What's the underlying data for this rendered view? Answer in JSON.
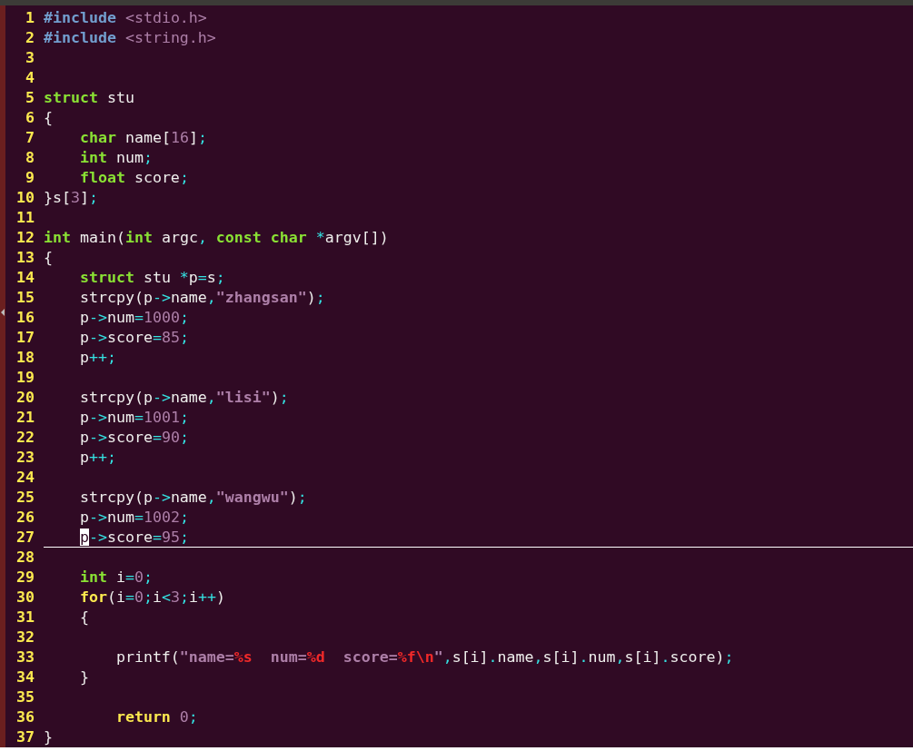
{
  "lines": [
    {
      "number": "1",
      "current": false,
      "tokens": [
        {
          "t": "#include",
          "kind": "pre"
        },
        {
          "t": " <stdio.h>",
          "kind": "inc"
        }
      ]
    },
    {
      "number": "2",
      "current": false,
      "tokens": [
        {
          "t": "#include",
          "kind": "pre"
        },
        {
          "t": " <string.h>",
          "kind": "inc"
        }
      ]
    },
    {
      "number": "3",
      "current": false
    },
    {
      "number": "4",
      "current": false
    },
    {
      "number": "5",
      "current": false,
      "tokens": [
        {
          "t": "struct",
          "kind": "type"
        },
        {
          "t": " stu",
          "kind": "plain"
        }
      ]
    },
    {
      "number": "6",
      "current": false,
      "tokens": [
        {
          "t": "{",
          "kind": "plain"
        }
      ]
    },
    {
      "number": "7",
      "current": false,
      "tokens": [
        {
          "t": "    char",
          "kind": "type"
        },
        {
          "t": " name[",
          "kind": "plain"
        },
        {
          "t": "16",
          "kind": "num"
        },
        {
          "t": "]",
          "kind": "plain"
        },
        {
          "t": ";",
          "kind": "op"
        }
      ]
    },
    {
      "number": "8",
      "current": false,
      "tokens": [
        {
          "t": "    int",
          "kind": "type"
        },
        {
          "t": " num",
          "kind": "plain"
        },
        {
          "t": ";",
          "kind": "op"
        }
      ]
    },
    {
      "number": "9",
      "current": false,
      "tokens": [
        {
          "t": "    float",
          "kind": "type"
        },
        {
          "t": " score",
          "kind": "plain"
        },
        {
          "t": ";",
          "kind": "op"
        }
      ]
    },
    {
      "number": "10",
      "current": false,
      "tokens": [
        {
          "t": "}s[",
          "kind": "plain"
        },
        {
          "t": "3",
          "kind": "num"
        },
        {
          "t": "]",
          "kind": "plain"
        },
        {
          "t": ";",
          "kind": "op"
        }
      ]
    },
    {
      "number": "11",
      "current": false
    },
    {
      "number": "12",
      "current": false,
      "tokens": [
        {
          "t": "int",
          "kind": "type"
        },
        {
          "t": " main(",
          "kind": "plain"
        },
        {
          "t": "int",
          "kind": "type"
        },
        {
          "t": " argc",
          "kind": "plain"
        },
        {
          "t": ",",
          "kind": "op"
        },
        {
          "t": " const",
          "kind": "type"
        },
        {
          "t": " char",
          "kind": "type"
        },
        {
          "t": " *",
          "kind": "op"
        },
        {
          "t": "argv[])",
          "kind": "plain"
        }
      ]
    },
    {
      "number": "13",
      "current": false,
      "tokens": [
        {
          "t": "{",
          "kind": "plain"
        }
      ]
    },
    {
      "number": "14",
      "current": false,
      "tokens": [
        {
          "t": "    struct",
          "kind": "type"
        },
        {
          "t": " stu ",
          "kind": "plain"
        },
        {
          "t": "*",
          "kind": "op"
        },
        {
          "t": "p",
          "kind": "plain"
        },
        {
          "t": "=",
          "kind": "op"
        },
        {
          "t": "s",
          "kind": "plain"
        },
        {
          "t": ";",
          "kind": "op"
        }
      ]
    },
    {
      "number": "15",
      "current": false,
      "tokens": [
        {
          "t": "    strcpy(p",
          "kind": "plain"
        },
        {
          "t": "->",
          "kind": "op"
        },
        {
          "t": "name",
          "kind": "plain"
        },
        {
          "t": ",",
          "kind": "op"
        },
        {
          "t": "\"zhangsan\"",
          "kind": "str"
        },
        {
          "t": ")",
          "kind": "plain"
        },
        {
          "t": ";",
          "kind": "op"
        }
      ]
    },
    {
      "number": "16",
      "current": false,
      "tokens": [
        {
          "t": "    p",
          "kind": "plain"
        },
        {
          "t": "->",
          "kind": "op"
        },
        {
          "t": "num",
          "kind": "plain"
        },
        {
          "t": "=",
          "kind": "op"
        },
        {
          "t": "1000",
          "kind": "num"
        },
        {
          "t": ";",
          "kind": "op"
        }
      ]
    },
    {
      "number": "17",
      "current": false,
      "tokens": [
        {
          "t": "    p",
          "kind": "plain"
        },
        {
          "t": "->",
          "kind": "op"
        },
        {
          "t": "score",
          "kind": "plain"
        },
        {
          "t": "=",
          "kind": "op"
        },
        {
          "t": "85",
          "kind": "num"
        },
        {
          "t": ";",
          "kind": "op"
        }
      ]
    },
    {
      "number": "18",
      "current": false,
      "tokens": [
        {
          "t": "    p",
          "kind": "plain"
        },
        {
          "t": "++;",
          "kind": "op"
        }
      ]
    },
    {
      "number": "19",
      "current": false
    },
    {
      "number": "20",
      "current": false,
      "tokens": [
        {
          "t": "    strcpy(p",
          "kind": "plain"
        },
        {
          "t": "->",
          "kind": "op"
        },
        {
          "t": "name",
          "kind": "plain"
        },
        {
          "t": ",",
          "kind": "op"
        },
        {
          "t": "\"lisi\"",
          "kind": "str"
        },
        {
          "t": ")",
          "kind": "plain"
        },
        {
          "t": ";",
          "kind": "op"
        }
      ]
    },
    {
      "number": "21",
      "current": false,
      "tokens": [
        {
          "t": "    p",
          "kind": "plain"
        },
        {
          "t": "->",
          "kind": "op"
        },
        {
          "t": "num",
          "kind": "plain"
        },
        {
          "t": "=",
          "kind": "op"
        },
        {
          "t": "1001",
          "kind": "num"
        },
        {
          "t": ";",
          "kind": "op"
        }
      ]
    },
    {
      "number": "22",
      "current": false,
      "tokens": [
        {
          "t": "    p",
          "kind": "plain"
        },
        {
          "t": "->",
          "kind": "op"
        },
        {
          "t": "score",
          "kind": "plain"
        },
        {
          "t": "=",
          "kind": "op"
        },
        {
          "t": "90",
          "kind": "num"
        },
        {
          "t": ";",
          "kind": "op"
        }
      ]
    },
    {
      "number": "23",
      "current": false,
      "tokens": [
        {
          "t": "    p",
          "kind": "plain"
        },
        {
          "t": "++;",
          "kind": "op"
        }
      ]
    },
    {
      "number": "24",
      "current": false
    },
    {
      "number": "25",
      "current": false,
      "tokens": [
        {
          "t": "    strcpy(p",
          "kind": "plain"
        },
        {
          "t": "->",
          "kind": "op"
        },
        {
          "t": "name",
          "kind": "plain"
        },
        {
          "t": ",",
          "kind": "op"
        },
        {
          "t": "\"wangwu\"",
          "kind": "str"
        },
        {
          "t": ")",
          "kind": "plain"
        },
        {
          "t": ";",
          "kind": "op"
        }
      ]
    },
    {
      "number": "26",
      "current": false,
      "tokens": [
        {
          "t": "    p",
          "kind": "plain"
        },
        {
          "t": "->",
          "kind": "op"
        },
        {
          "t": "num",
          "kind": "plain"
        },
        {
          "t": "=",
          "kind": "op"
        },
        {
          "t": "1002",
          "kind": "num"
        },
        {
          "t": ";",
          "kind": "op"
        }
      ]
    },
    {
      "number": "27",
      "current": true,
      "tokens": [
        {
          "t": "    p",
          "kind": "cursor"
        },
        {
          "t": "->",
          "kind": "op"
        },
        {
          "t": "score",
          "kind": "plain"
        },
        {
          "t": "=",
          "kind": "op"
        },
        {
          "t": "95",
          "kind": "num"
        },
        {
          "t": ";",
          "kind": "op"
        }
      ]
    },
    {
      "number": "28",
      "current": false
    },
    {
      "number": "29",
      "current": false,
      "tokens": [
        {
          "t": "    int",
          "kind": "type"
        },
        {
          "t": " i",
          "kind": "plain"
        },
        {
          "t": "=",
          "kind": "op"
        },
        {
          "t": "0",
          "kind": "num"
        },
        {
          "t": ";",
          "kind": "op"
        }
      ]
    },
    {
      "number": "30",
      "current": false,
      "tokens": [
        {
          "t": "    for",
          "kind": "kw"
        },
        {
          "t": "(i",
          "kind": "plain"
        },
        {
          "t": "=",
          "kind": "op"
        },
        {
          "t": "0",
          "kind": "num"
        },
        {
          "t": ";",
          "kind": "op"
        },
        {
          "t": "i",
          "kind": "plain"
        },
        {
          "t": "<",
          "kind": "op"
        },
        {
          "t": "3",
          "kind": "num"
        },
        {
          "t": ";",
          "kind": "op"
        },
        {
          "t": "i",
          "kind": "plain"
        },
        {
          "t": "++",
          "kind": "op"
        },
        {
          "t": ")",
          "kind": "plain"
        }
      ]
    },
    {
      "number": "31",
      "current": false,
      "tokens": [
        {
          "t": "    {",
          "kind": "plain"
        }
      ]
    },
    {
      "number": "32",
      "current": false
    },
    {
      "number": "33",
      "current": false,
      "tokens": [
        {
          "t": "        printf(",
          "kind": "plain"
        },
        {
          "t": "\"name=",
          "kind": "str"
        },
        {
          "t": "%s",
          "kind": "fmt"
        },
        {
          "t": "  num=",
          "kind": "str"
        },
        {
          "t": "%d",
          "kind": "fmt"
        },
        {
          "t": "  score=",
          "kind": "str"
        },
        {
          "t": "%f\\n",
          "kind": "fmt"
        },
        {
          "t": "\"",
          "kind": "str"
        },
        {
          "t": ",",
          "kind": "op"
        },
        {
          "t": "s[i]",
          "kind": "plain"
        },
        {
          "t": ".",
          "kind": "op"
        },
        {
          "t": "name",
          "kind": "plain"
        },
        {
          "t": ",",
          "kind": "op"
        },
        {
          "t": "s[i]",
          "kind": "plain"
        },
        {
          "t": ".",
          "kind": "op"
        },
        {
          "t": "num",
          "kind": "plain"
        },
        {
          "t": ",",
          "kind": "op"
        },
        {
          "t": "s[i]",
          "kind": "plain"
        },
        {
          "t": ".",
          "kind": "op"
        },
        {
          "t": "score)",
          "kind": "plain"
        },
        {
          "t": ";",
          "kind": "op"
        }
      ]
    },
    {
      "number": "34",
      "current": false,
      "tokens": [
        {
          "t": "    }",
          "kind": "plain"
        }
      ]
    },
    {
      "number": "35",
      "current": false
    },
    {
      "number": "36",
      "current": false,
      "tokens": [
        {
          "t": "        return",
          "kind": "kw"
        },
        {
          "t": " 0",
          "kind": "num"
        },
        {
          "t": ";",
          "kind": "op"
        }
      ]
    },
    {
      "number": "37",
      "current": false,
      "tokens": [
        {
          "t": "}",
          "kind": "plain"
        }
      ]
    }
  ]
}
